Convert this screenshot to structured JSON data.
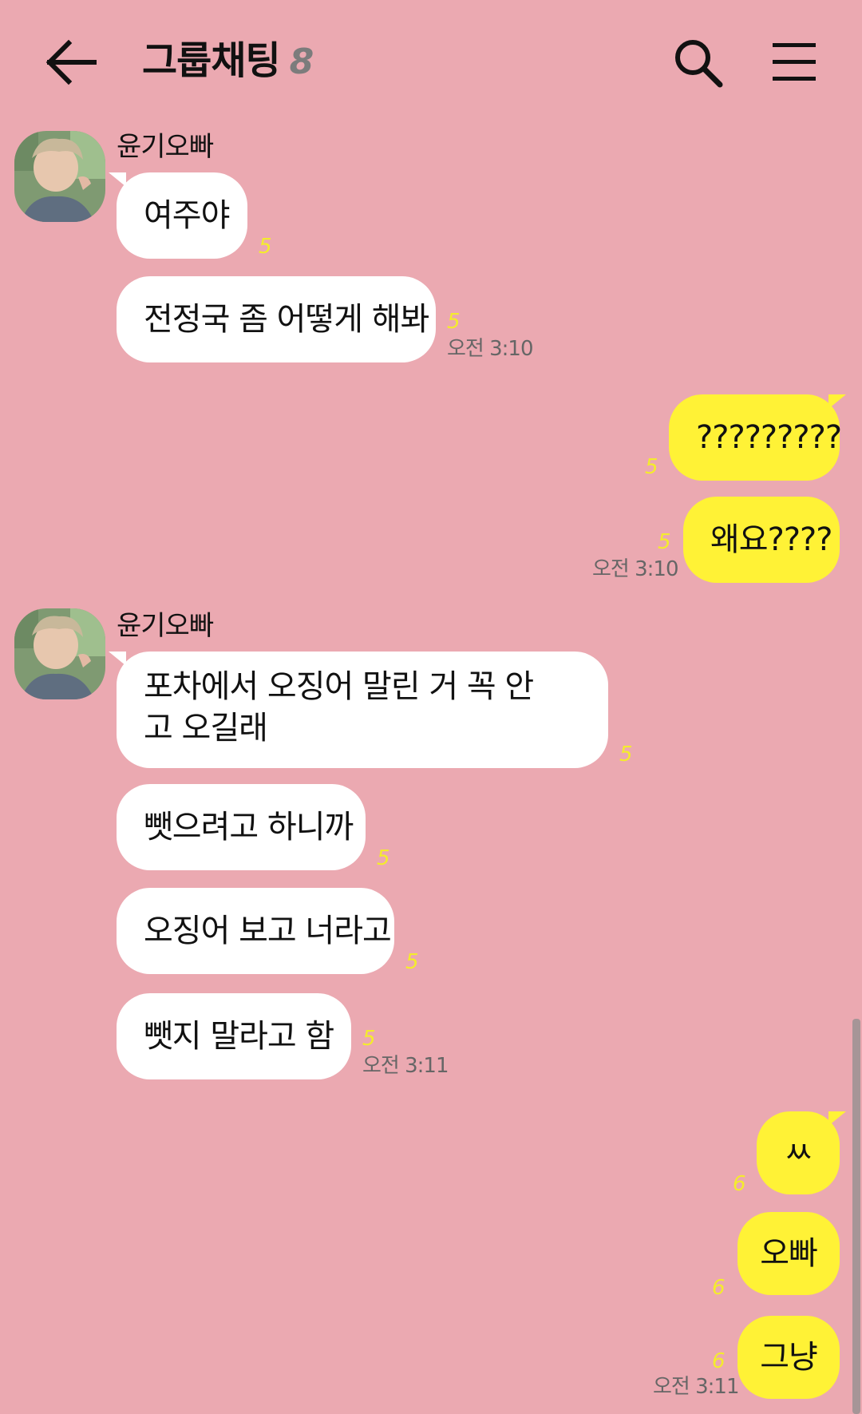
{
  "header": {
    "back_icon": "arrow-left-icon",
    "title": "그룹채팅",
    "member_count": "8",
    "search_icon": "search-icon",
    "menu_icon": "hamburger-menu-icon"
  },
  "messages": [
    {
      "sender": "윤기오빠",
      "direction": "incoming",
      "text": "여주야",
      "unread": "5"
    },
    {
      "direction": "incoming",
      "text": "전정국 좀 어떻게 해봐",
      "unread": "5",
      "time": "오전 3:10"
    },
    {
      "direction": "outgoing",
      "text": "?????????",
      "unread": "5"
    },
    {
      "direction": "outgoing",
      "text": "왜요????",
      "unread": "5",
      "time": "오전 3:10"
    },
    {
      "sender": "윤기오빠",
      "direction": "incoming",
      "text": "포차에서 오징어 말린 거 꼭 안고 오길래",
      "unread": "5"
    },
    {
      "direction": "incoming",
      "text": "뺏으려고 하니까",
      "unread": "5"
    },
    {
      "direction": "incoming",
      "text": "오징어 보고 너라고",
      "unread": "5"
    },
    {
      "direction": "incoming",
      "text": "뺏지 말라고 함",
      "unread": "5",
      "time": "오전 3:11"
    },
    {
      "direction": "outgoing",
      "text": "ㅆ",
      "unread": "6"
    },
    {
      "direction": "outgoing",
      "text": "오빠",
      "unread": "6"
    },
    {
      "direction": "outgoing",
      "text": "그냥",
      "unread": "6",
      "time": "오전 3:11"
    }
  ],
  "colors": {
    "background": "#eba9b1",
    "incoming_bubble": "#ffffff",
    "outgoing_bubble": "#fff236",
    "unread_count": "#f4ec2c",
    "member_count": "#7c7c7c"
  }
}
